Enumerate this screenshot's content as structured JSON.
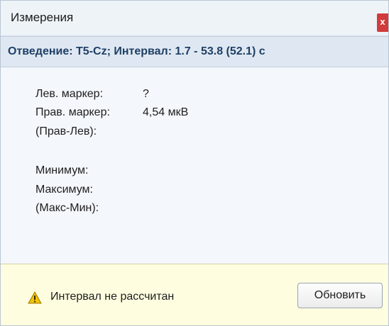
{
  "window": {
    "title": "Измерения",
    "close_label": "x"
  },
  "subheader": {
    "text": "Отведение: T5-Cz; Интервал: 1.7 - 53.8 (52.1) с"
  },
  "measurements": {
    "left_marker": {
      "label": "Лев. маркер:",
      "value": "?"
    },
    "right_marker": {
      "label": "Прав. маркер:",
      "value": "4,54 мкВ"
    },
    "diff_markers": {
      "label": "(Прав-Лев):",
      "value": ""
    },
    "minimum": {
      "label": "Минимум:",
      "value": ""
    },
    "maximum": {
      "label": "Максимум:",
      "value": ""
    },
    "diff_minmax": {
      "label": "(Макс-Мин):",
      "value": ""
    }
  },
  "footer": {
    "warning_text": "Интервал не рассчитан",
    "warning_icon": "warning-triangle-icon",
    "refresh_label": "Обновить"
  },
  "colors": {
    "close_button": "#d13b3b",
    "subheader_text": "#1f3f66",
    "footer_bg": "#fffde0",
    "warning_icon": "#f2c200"
  }
}
